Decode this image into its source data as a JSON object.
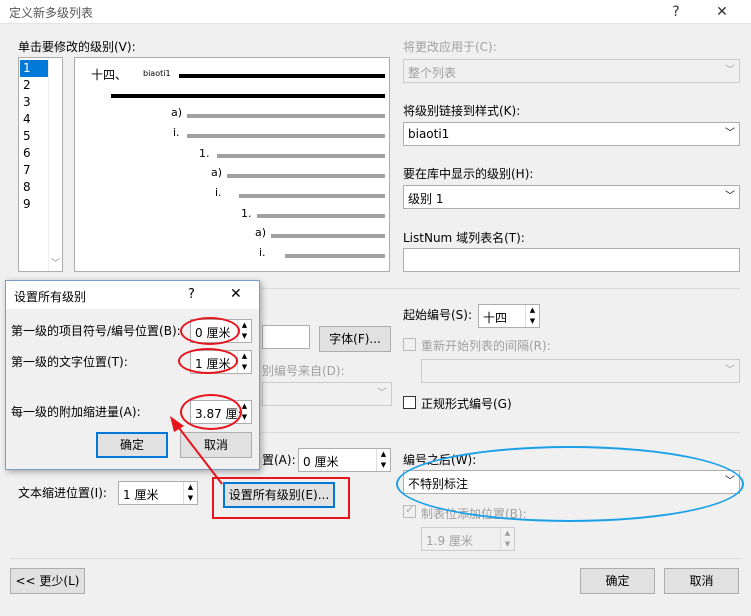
{
  "window": {
    "title": "定义新多级列表",
    "help": "?",
    "close": "✕"
  },
  "left": {
    "levels_label": "单击要修改的级别(V):",
    "levels": [
      "1",
      "2",
      "3",
      "4",
      "5",
      "6",
      "7",
      "8",
      "9"
    ],
    "selected_level": "1",
    "preview": {
      "items": [
        "十四、",
        "biaoti1",
        "a)",
        "i.",
        "1.",
        "a)",
        "i.",
        "1.",
        "a)",
        "i."
      ]
    }
  },
  "right": {
    "apply_to_label": "将更改应用于(C):",
    "apply_to_value": "整个列表",
    "link_style_label": "将级别链接到样式(K):",
    "link_style_value": "biaoti1",
    "gallery_level_label": "要在库中显示的级别(H):",
    "gallery_level_value": "级别 1",
    "listnum_label": "ListNum 域列表名(T):",
    "listnum_value": "",
    "start_at_label": "起始编号(S):",
    "start_at_value": "十四",
    "restart_label": "重新开始列表的间隔(R):",
    "legal_label": "正规形式编号(G)",
    "follow_label": "编号之后(W):",
    "follow_value": "不特别标注",
    "tab_add_label": "制表位添加位置(B):",
    "tab_add_value": "1.9 厘米"
  },
  "middle": {
    "font_button": "字体(F)...",
    "include_level_label": "别编号来自(D):",
    "aligned_at_label": "置(A):",
    "aligned_at_value": "0 厘米",
    "indent_label": "文本缩进位置(I):",
    "indent_value": "1 厘米",
    "set_all_button": "设置所有级别(E)..."
  },
  "footer": {
    "less_button": "<< 更少(L)",
    "ok_button": "确定",
    "cancel_button": "取消"
  },
  "popup": {
    "title": "设置所有级别",
    "help": "?",
    "close": "✕",
    "bullet_pos_label": "第一级的项目符号/编号位置(B):",
    "bullet_pos_value": "0 厘米",
    "text_pos_label": "第一级的文字位置(T):",
    "text_pos_value": "1 厘米",
    "indent_label": "每一级的附加缩进量(A):",
    "indent_value": "3.87 厘:",
    "ok": "确定",
    "cancel": "取消"
  }
}
